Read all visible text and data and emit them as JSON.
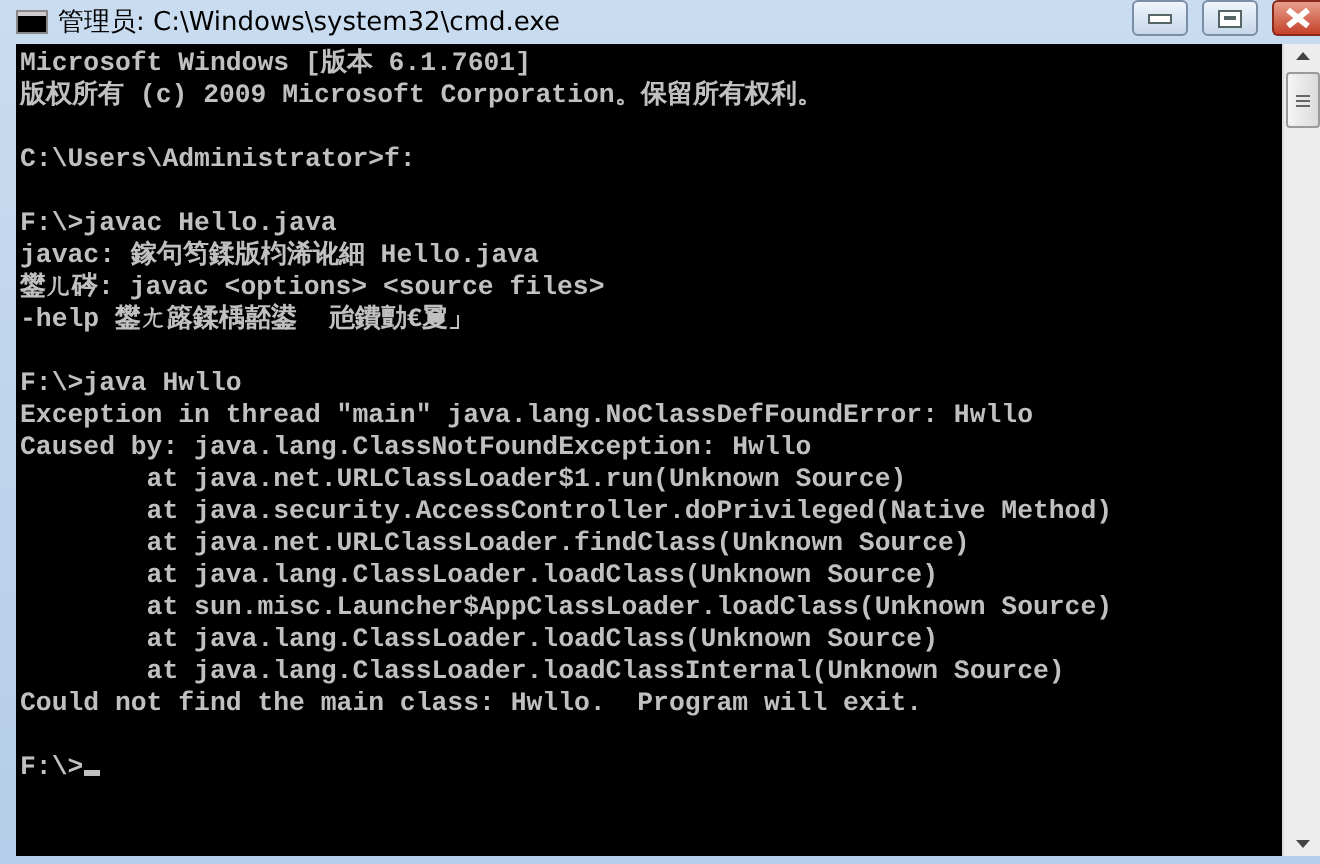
{
  "window": {
    "title": "管理员: C:\\Windows\\system32\\cmd.exe"
  },
  "console": {
    "cursor": true,
    "blocks": [
      [
        "Microsoft Windows [版本 6.1.7601]",
        "版权所有 (c) 2009 Microsoft Corporation。保留所有权利。"
      ],
      [
        "C:\\Users\\Administrator>f:"
      ],
      [
        "F:\\>javac Hello.java",
        "javac: 鎵句笉鍒版枃浠讹細 Hello.java",
        "鐢ㄦ硶: javac <options> <source files>",
        "-help 鐢ㄤ簬鍒楀嚭鍙  兘鐨勯€夐」"
      ],
      [
        "F:\\>java Hwllo",
        "Exception in thread \"main\" java.lang.NoClassDefFoundError: Hwllo",
        "Caused by: java.lang.ClassNotFoundException: Hwllo",
        "        at java.net.URLClassLoader$1.run(Unknown Source)",
        "        at java.security.AccessController.doPrivileged(Native Method)",
        "        at java.net.URLClassLoader.findClass(Unknown Source)",
        "        at java.lang.ClassLoader.loadClass(Unknown Source)",
        "        at sun.misc.Launcher$AppClassLoader.loadClass(Unknown Source)",
        "        at java.lang.ClassLoader.loadClass(Unknown Source)",
        "        at java.lang.ClassLoader.loadClassInternal(Unknown Source)",
        "Could not find the main class: Hwllo.  Program will exit."
      ],
      [
        "F:\\>"
      ]
    ]
  }
}
